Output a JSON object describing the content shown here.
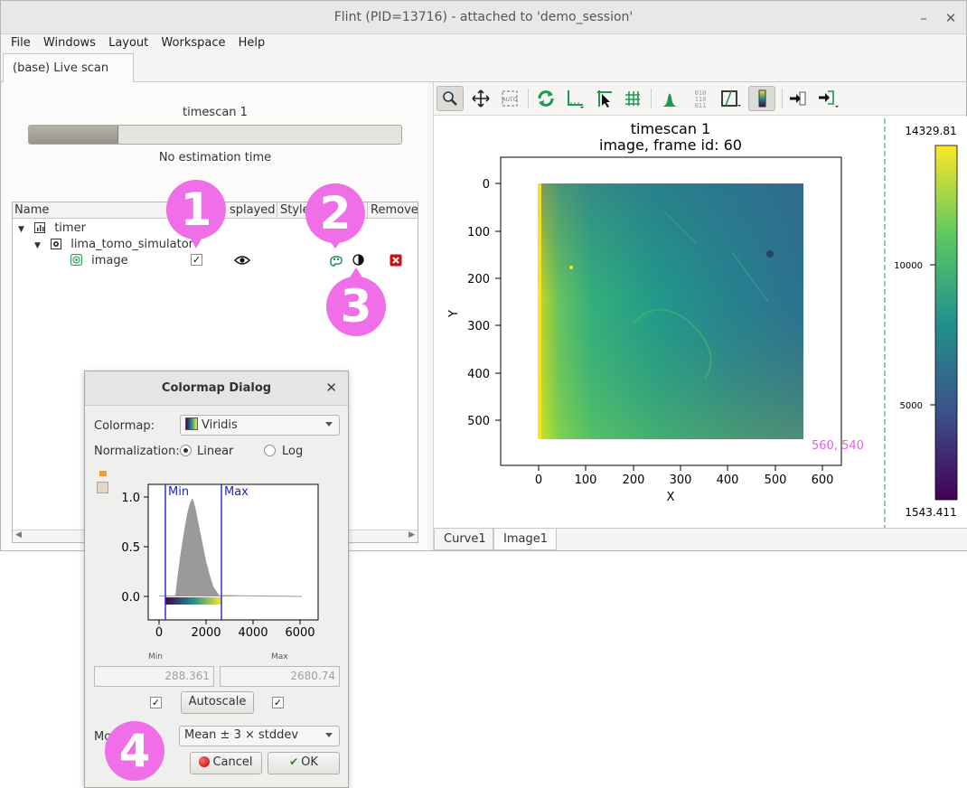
{
  "window": {
    "title": "Flint (PID=13716) - attached to 'demo_session'"
  },
  "menu": [
    "File",
    "Windows",
    "Layout",
    "Workspace",
    "Help"
  ],
  "tabs": {
    "live_scan": "(base) Live scan"
  },
  "scan": {
    "title": "timescan 1",
    "progress": 0.24,
    "estimation": "No estimation time"
  },
  "tree": {
    "columns": [
      "Name",
      "splayed",
      "Style",
      "Remove"
    ],
    "rows": [
      {
        "label": "timer"
      },
      {
        "label": "lima_tomo_simulator"
      },
      {
        "label": "image",
        "checked": "✓"
      }
    ]
  },
  "plot": {
    "title_line1": "timescan 1",
    "title_line2": "image, frame id: 60",
    "xlabel": "X",
    "ylabel": "Y",
    "x_ticks": [
      "0",
      "100",
      "200",
      "300",
      "400",
      "500",
      "600"
    ],
    "y_ticks": [
      "0",
      "100",
      "200",
      "300",
      "400",
      "500"
    ],
    "coord_readout": "560, 540",
    "colorbar": {
      "max_label": "14329.81",
      "min_label": "1543.411",
      "ticks": [
        "10000",
        "5000"
      ]
    }
  },
  "bottom_tabs": [
    "Curve1",
    "Image1"
  ],
  "dialog": {
    "title": "Colormap Dialog",
    "colormap_label": "Colormap:",
    "colormap_value": "Viridis",
    "normalization_label": "Normalization:",
    "linear": "Linear",
    "log": "Log",
    "hist_min": "Min",
    "hist_max": "Max",
    "hist_y_ticks": [
      "1.0",
      "0.5",
      "0.0"
    ],
    "hist_x_ticks": [
      "0",
      "2000",
      "4000",
      "6000"
    ],
    "min_caption": "Min",
    "max_caption": "Max",
    "min_value": "288.361",
    "max_value": "2680.74",
    "autoscale": "Autoscale",
    "mode_label": "Mo",
    "mode_value": "Mean ± 3 × stddev",
    "cancel": "Cancel",
    "ok": "OK"
  },
  "annotations": [
    "1",
    "2",
    "3",
    "4"
  ],
  "colors": {
    "accent_bubble": "#f06ee8",
    "remove_red": "#cc1111",
    "coord_text": "#e85ee0"
  }
}
